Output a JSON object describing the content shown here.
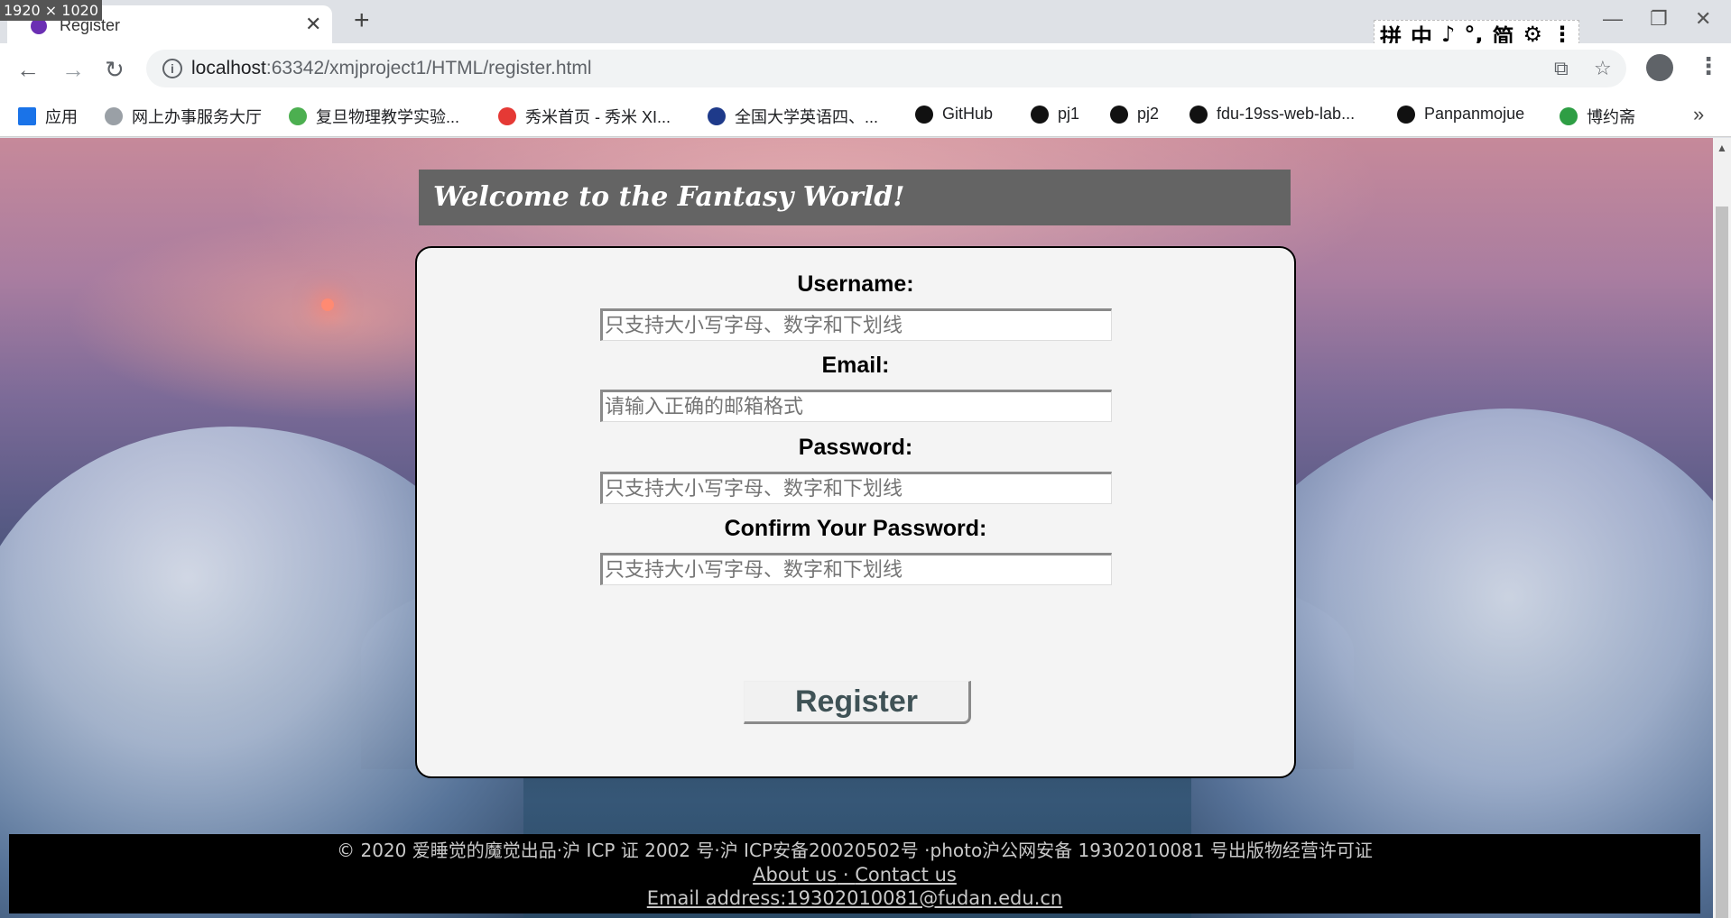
{
  "browser": {
    "dimension_label": "1920 × 1020",
    "tab_title": "Register",
    "ime_items": [
      "拼",
      "中",
      "♪",
      "°,",
      "简",
      "⚙",
      "⋮"
    ],
    "url_host": "localhost",
    "url_rest": ":63342/xmjproject1/HTML/register.html",
    "bookmarks": [
      {
        "label": "应用",
        "color": "#1a73e8"
      },
      {
        "label": "网上办事服务大厅",
        "color": "#9aa0a6"
      },
      {
        "label": "复旦物理教学实验...",
        "color": "#4caf50"
      },
      {
        "label": "秀米首页 - 秀米 XI...",
        "color": "#e53935"
      },
      {
        "label": "全国大学英语四、...",
        "color": "#1e3a8a"
      },
      {
        "label": "GitHub",
        "color": "#111111"
      },
      {
        "label": "pj1",
        "color": "#111111"
      },
      {
        "label": "pj2",
        "color": "#111111"
      },
      {
        "label": "fdu-19ss-web-lab...",
        "color": "#111111"
      },
      {
        "label": "Panpanmojue",
        "color": "#111111"
      },
      {
        "label": "博约斋",
        "color": "#2e9e44"
      }
    ],
    "bookmarks_more": "»"
  },
  "page": {
    "welcome": "Welcome to the Fantasy World!",
    "form": {
      "username_label": "Username:",
      "username_placeholder": "只支持大小写字母、数字和下划线",
      "email_label": "Email:",
      "email_placeholder": "请输入正确的邮箱格式",
      "password_label": "Password:",
      "password_placeholder": "只支持大小写字母、数字和下划线",
      "confirm_label": "Confirm Your Password:",
      "confirm_placeholder": "只支持大小写字母、数字和下划线",
      "register_label": "Register"
    },
    "footer": {
      "copyright": "© 2020 爱睡觉的魔觉出品·沪 ICP 证 2002 号·沪 ICP安备20020502号 ·photo沪公网安备 19302010081 号出版物经营许可证",
      "about": "About us",
      "separator": " · ",
      "contact": "Contact us",
      "email": "Email address:19302010081@fudan.edu.cn"
    }
  }
}
